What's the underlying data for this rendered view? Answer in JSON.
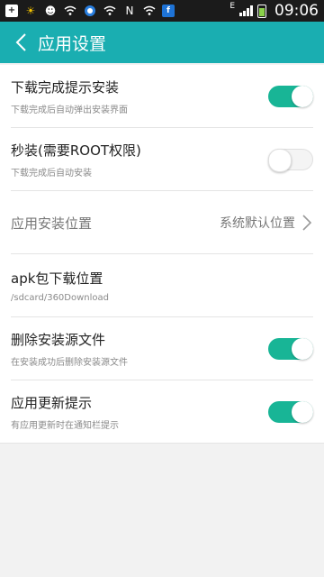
{
  "status_bar": {
    "time": "09:06",
    "network_label": "E",
    "icons": [
      "add-icon",
      "sun-icon",
      "assistant-icon",
      "wifi-icon",
      "browser-icon",
      "wifi-icon",
      "nfc-icon",
      "wifi-icon",
      "app-icon"
    ],
    "battery_level": 0.8
  },
  "header": {
    "title": "应用设置",
    "bg_color": "#1aaeb1"
  },
  "settings": {
    "items": [
      {
        "title": "下载完成提示安装",
        "subtitle": "下载完成后自动弹出安装界面",
        "toggle": true
      },
      {
        "title": "秒装(需要ROOT权限)",
        "subtitle": "下载完成后自动安装",
        "toggle": false
      },
      {
        "title": "应用安装位置",
        "value": "系统默认位置"
      },
      {
        "title": "apk包下载位置",
        "subtitle": "/sdcard/360Download"
      },
      {
        "title": "删除安装源文件",
        "subtitle": "在安装成功后删除安装源文件",
        "toggle": true
      },
      {
        "title": "应用更新提示",
        "subtitle": "有应用更新时在通知栏提示",
        "toggle": true
      }
    ]
  },
  "colors": {
    "toggle_on": "#18b596",
    "toggle_off": "#f4f4f4"
  }
}
